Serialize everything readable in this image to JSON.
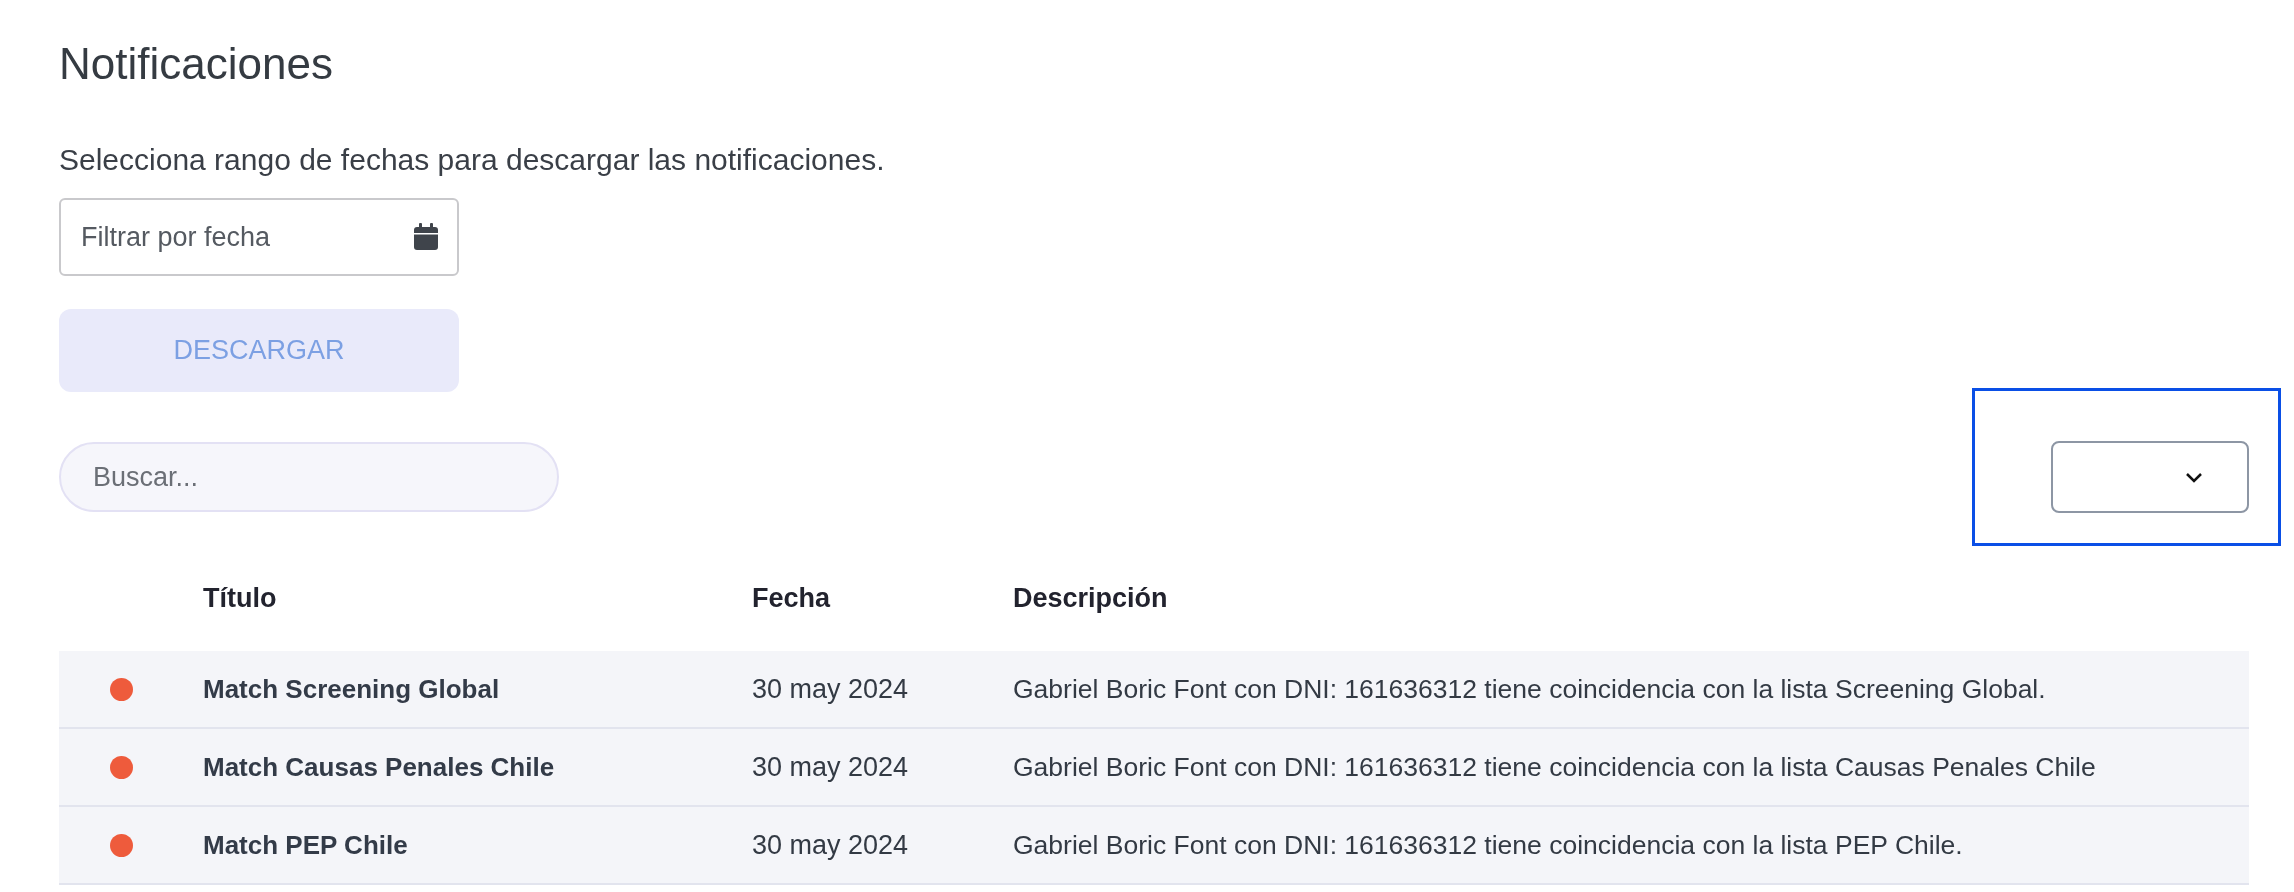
{
  "page_title": "Notificaciones",
  "instructions": "Selecciona rango de fechas para descargar las notificaciones.",
  "date_filter": {
    "placeholder": "Filtrar por fecha"
  },
  "download_button": {
    "label": "DESCARGAR",
    "disabled": true
  },
  "search": {
    "placeholder": "Buscar..."
  },
  "page_select": {
    "highlighted": true
  },
  "table": {
    "columns": [
      "Título",
      "Fecha",
      "Descripción"
    ],
    "rows": [
      {
        "unread": true,
        "title": "Match Screening Global",
        "date": "30 may 2024",
        "description": "Gabriel Boric Font con DNI: 161636312 tiene coincidencia con la lista Screening Global."
      },
      {
        "unread": true,
        "title": "Match Causas Penales Chile",
        "date": "30 may 2024",
        "description": "Gabriel Boric Font con DNI: 161636312 tiene coincidencia con la lista Causas Penales Chile"
      },
      {
        "unread": true,
        "title": "Match PEP Chile",
        "date": "30 may 2024",
        "description": "Gabriel Boric Font con DNI: 161636312 tiene coincidencia con la lista PEP Chile."
      }
    ]
  }
}
